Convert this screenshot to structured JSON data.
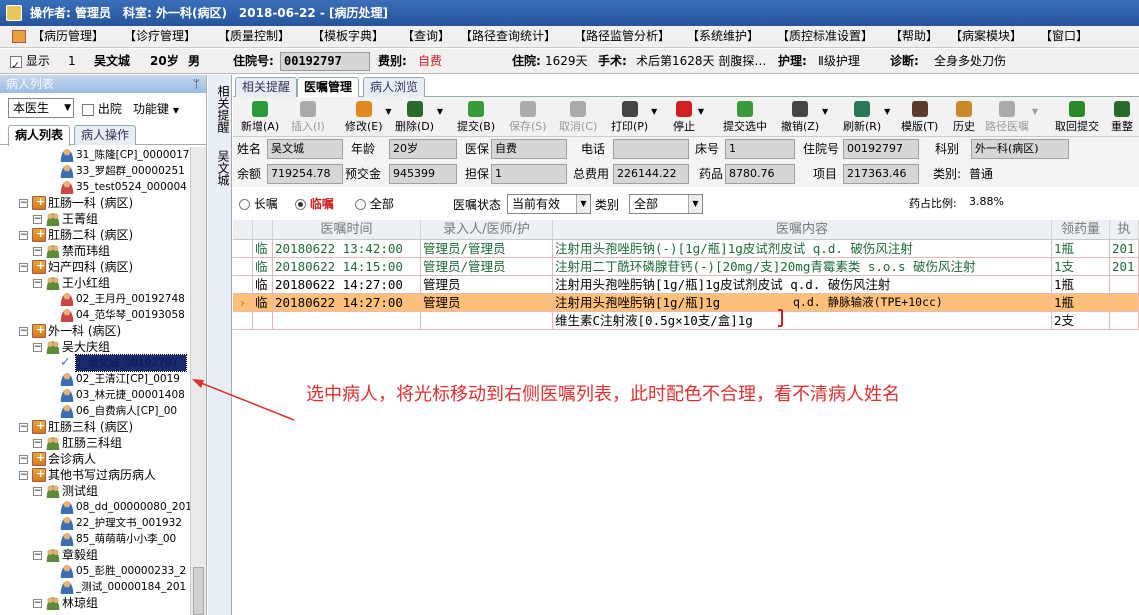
{
  "titlebar": {
    "text": "操作者: 管理员　科室: 外一科(病区)　2018-06-22 - [病历处理]"
  },
  "menu": [
    "【病历管理】",
    "【诊疗管理】",
    "【质量控制】",
    "【模板字典】",
    "【查询】",
    "【路径查询统计】",
    "【路径监管分析】",
    "【系统维护】",
    "【质控标准设置】",
    "【帮助】",
    "【病案模块】",
    "【窗口】"
  ],
  "info": {
    "show_label": "显示",
    "bed": "1",
    "name": "吴文城",
    "age": "20岁",
    "sex": "男",
    "admission_label": "住院号:",
    "admission_no": "00192797",
    "fee_label": "费别:",
    "fee_value": "自费",
    "days_label": "住院:",
    "days_value": "1629天",
    "surgery_label": "手术:",
    "surgery_value": "术后第1628天 剖腹探…",
    "nursing_label": "护理:",
    "nursing_value": "Ⅱ级护理",
    "diagnosis_label": "诊断:",
    "diagnosis_value": "全身多处刀伤"
  },
  "left": {
    "title": "病人列表",
    "pin": "ᛘ",
    "doctor_select": "本医生",
    "discharged": "出院",
    "func_key": "功能键",
    "tab_list": "病人列表",
    "tab_ops": "病人操作"
  },
  "tree": [
    {
      "text": "31_陈隆[CP]_0000017",
      "type": "person",
      "level": 3
    },
    {
      "text": "33_罗超群_00000251",
      "type": "person",
      "level": 3
    },
    {
      "text": "35_test0524_000004",
      "type": "personr",
      "level": 3
    },
    {
      "text": "肛肠一科 (病区)",
      "type": "dept",
      "level": 1
    },
    {
      "text": "王菁组",
      "type": "grp",
      "level": 2
    },
    {
      "text": "肛肠二科 (病区)",
      "type": "dept",
      "level": 1
    },
    {
      "text": "禁而玮组",
      "type": "grp",
      "level": 2
    },
    {
      "text": "妇产四科 (病区)",
      "type": "dept",
      "level": 1
    },
    {
      "text": "王小红组",
      "type": "grp",
      "level": 2
    },
    {
      "text": "02_王月丹_00192748",
      "type": "personr",
      "level": 3
    },
    {
      "text": "04_范华琴_00193058",
      "type": "personr",
      "level": 3
    },
    {
      "text": "外一科 (病区)",
      "type": "dept",
      "level": 1
    },
    {
      "text": "吴大庆组",
      "type": "grp",
      "level": 2
    },
    {
      "text": "1_吴文城_00192797",
      "type": "check",
      "level": 3,
      "selected": true
    },
    {
      "text": "02_王清江[CP]_0019",
      "type": "person",
      "level": 3
    },
    {
      "text": "03_林元捷_00001408",
      "type": "person",
      "level": 3
    },
    {
      "text": "06_自费病人[CP]_00",
      "type": "person",
      "level": 3
    },
    {
      "text": "肛肠三科 (病区)",
      "type": "dept",
      "level": 1
    },
    {
      "text": "肛肠三科组",
      "type": "grp",
      "level": 2
    },
    {
      "text": "会诊病人",
      "type": "dept",
      "level": 1
    },
    {
      "text": "其他书写过病历病人",
      "type": "dept",
      "level": 1
    },
    {
      "text": "测试组",
      "type": "grp",
      "level": 2
    },
    {
      "text": "08_dd_00000080_201",
      "type": "person",
      "level": 3
    },
    {
      "text": "22_护理文书_001932",
      "type": "person",
      "level": 3
    },
    {
      "text": "85_萌萌萌小小李_00",
      "type": "person",
      "level": 3
    },
    {
      "text": "章毅组",
      "type": "grp",
      "level": 2
    },
    {
      "text": "05_彭胜_00000233_2",
      "type": "person",
      "level": 3
    },
    {
      "text": "_测试_00000184_201",
      "type": "person",
      "level": 3
    },
    {
      "text": "林琼组",
      "type": "grp",
      "level": 2
    }
  ],
  "sidetabs": {
    "tab1": "相关提醒",
    "tab2": "吴文城"
  },
  "rtabs": [
    "相关提醒",
    "医嘱管理",
    "病人浏览"
  ],
  "toolbar": [
    {
      "label": "新增(A)",
      "color": "#2a9a3a"
    },
    {
      "label": "插入(I)",
      "color": "#aaaaaa",
      "dis": true
    },
    {
      "label": "修改(E)",
      "color": "#e08a20",
      "dd": true
    },
    {
      "label": "删除(D)",
      "color": "#2a6a2a",
      "dd": true
    },
    {
      "label": "提交(B)",
      "color": "#3a9a3a"
    },
    {
      "label": "保存(S)",
      "color": "#aaaaaa",
      "dis": true
    },
    {
      "label": "取消(C)",
      "color": "#aaaaaa",
      "dis": true
    },
    {
      "label": "打印(P)",
      "color": "#444444",
      "dd": true
    },
    {
      "label": "停止",
      "color": "#d02020",
      "dd": true
    },
    {
      "label": "提交选中",
      "color": "#3a9a3a"
    },
    {
      "label": "撤销(Z)",
      "color": "#444444",
      "dd": true
    },
    {
      "label": "刷新(R)",
      "color": "#2a7a5a",
      "dd": true
    },
    {
      "label": "模版(T)",
      "color": "#5a3a2a"
    },
    {
      "label": "历史",
      "color": "#c88a2a"
    },
    {
      "label": "路径医嘱",
      "color": "#aaaaaa",
      "dis": true,
      "dd": true
    },
    {
      "label": "取回提交",
      "color": "#2a8a2a"
    },
    {
      "label": "重整",
      "color": "#2a6a2a"
    }
  ],
  "form": {
    "name_label": "姓名",
    "name": "吴文城",
    "age_label": "年龄",
    "age": "20岁",
    "ins_label": "医保",
    "ins": "自费",
    "phone_label": "电话",
    "phone": "",
    "bed_label": "床号",
    "bed": "1",
    "adm_label": "住院号",
    "adm": "00192797",
    "dept_label": "科别",
    "dept": "外一科(病区)",
    "bal_label": "余额",
    "bal": "719254.78",
    "dep_label": "预交金",
    "dep": "945399",
    "guar_label": "担保",
    "guar": "1",
    "total_label": "总费用",
    "total": "226144.22",
    "drug_label": "药品",
    "drug": "8780.76",
    "item_label": "项目",
    "item": "217363.46",
    "type_label": "类别:",
    "type": "普通"
  },
  "filter": {
    "long": "长嘱",
    "temp": "临嘱",
    "all": "全部",
    "status_label": "医嘱状态",
    "status": "当前有效",
    "category_label": "类别",
    "category": "全部",
    "ratio_label": "药占比例:",
    "ratio": "3.88%"
  },
  "grid": {
    "headers": [
      "医嘱时间",
      "录入人/医师/护",
      "医嘱内容",
      "领药量",
      "执"
    ],
    "rows": [
      {
        "flag": "临",
        "time": "20180622 13:42:00",
        "person": "管理员/管理员",
        "content": "注射用头孢唑肟钠(-)[1g/瓶]1g皮试剂皮试 q.d. 破伤风注射",
        "qty": "1瓶",
        "exec": "201",
        "green": true
      },
      {
        "flag": "临",
        "time": "20180622 14:15:00",
        "person": "管理员/管理员",
        "content": "注射用二丁酰环磷腺苷钙(-)[20mg/支]20mg青霉素类 s.o.s 破伤风注射",
        "qty": "1支",
        "exec": "201",
        "green": true
      },
      {
        "flag": "临",
        "time": "20180622 14:27:00",
        "person": "管理员",
        "content": "注射用头孢唑肟钠[1g/瓶]1g皮试剂皮试 q.d. 破伤风注射",
        "qty": "1瓶",
        "exec": "",
        "green": false
      },
      {
        "flag": "临",
        "time": "20180622 14:27:00",
        "person": "管理员",
        "content": "注射用头孢唑肟钠[1g/瓶]1g",
        "content2": "q.d. 静脉输液(TPE+10cc)",
        "qty": "1瓶",
        "exec": "",
        "green": false,
        "selected": true
      },
      {
        "flag": "",
        "time": "",
        "person": "",
        "content": "维生素C注射液[0.5g×10支/盒]1g",
        "qty": "2支",
        "exec": "",
        "green": false
      }
    ]
  },
  "annotation": "选中病人，将光标移动到右侧医嘱列表，此时配色不合理，看不清病人姓名"
}
